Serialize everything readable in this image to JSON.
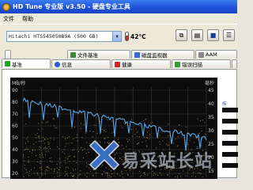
{
  "window": {
    "title": "HD Tune 专业版 v3.50 - 硬盘专业工具"
  },
  "menu": {
    "items": [
      "文件",
      "帮助"
    ]
  },
  "toolbar": {
    "drive": "Hitachi HTS545050B9A (500 GB)",
    "temperature": "42°C"
  },
  "tabs": {
    "row1": [
      {
        "label": "文件基准",
        "icon": "file-icon"
      },
      {
        "label": "磁盘监视器",
        "icon": "monitor-icon"
      },
      {
        "label": "AAM",
        "icon": "speaker-icon"
      }
    ],
    "row2": [
      {
        "label": "基准",
        "icon": "benchmark-icon"
      },
      {
        "label": "信息",
        "icon": "info-icon"
      },
      {
        "label": "健康",
        "icon": "health-icon"
      },
      {
        "label": "错误扫描",
        "icon": "scan-icon"
      }
    ]
  },
  "chart": {
    "ylabel_left": "MB/秒",
    "ylabel_right": "毫秒",
    "yticks_left": [
      "90",
      "80",
      "70",
      "60",
      "50",
      "40",
      "30",
      "20"
    ],
    "yticks_right": [
      "45",
      "40",
      "35",
      "30",
      "25",
      "20",
      "15"
    ]
  },
  "side_panel": {
    "label": "传"
  },
  "colors": {
    "title_bar": "#1d4fd6",
    "chart_bg": "#0c0c0c",
    "transfer_line": "#5aa6e8",
    "access_dots": "#d8c36a"
  },
  "watermark": {
    "text": "易采站长站"
  }
}
